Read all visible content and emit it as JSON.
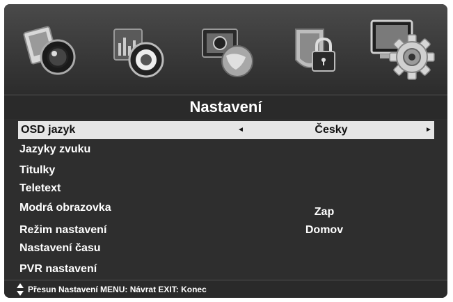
{
  "menu_icons": [
    {
      "name": "picture-menu-icon"
    },
    {
      "name": "sound-menu-icon"
    },
    {
      "name": "channel-menu-icon"
    },
    {
      "name": "lock-menu-icon"
    },
    {
      "name": "settings-menu-icon",
      "active": true
    }
  ],
  "title": "Nastavení",
  "items": [
    {
      "label": "OSD jazyk",
      "value": "Česky",
      "selected": true,
      "left_arrow": "◄",
      "right_arrow": "►"
    },
    {
      "label": "Jazyky zvuku",
      "value": ""
    },
    {
      "label": "Titulky",
      "value": ""
    },
    {
      "label": "Teletext",
      "value": ""
    },
    {
      "label": "Modrá obrazovka",
      "value": "Zap"
    },
    {
      "label": "Režim nastavení",
      "value": "Domov"
    },
    {
      "label": "Nastavení času",
      "value": ""
    },
    {
      "label": "PVR nastavení",
      "value": ""
    }
  ],
  "footer": {
    "help_text": "Přesun Nastavení MENU: Návrat EXIT: Konec"
  },
  "colors": {
    "background": "#2e2e2e",
    "highlight": "#e6e6e6",
    "text": "#ffffff"
  }
}
